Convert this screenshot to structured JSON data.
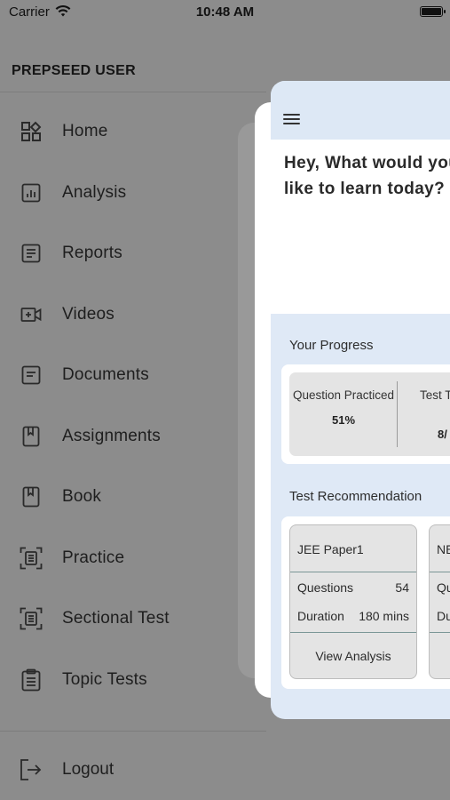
{
  "status_bar": {
    "carrier": "Carrier",
    "time": "10:48 AM"
  },
  "drawer": {
    "title": "PREPSEED USER",
    "items": [
      {
        "label": "Home",
        "icon": "home-grid-icon"
      },
      {
        "label": "Analysis",
        "icon": "analysis-chart-icon"
      },
      {
        "label": "Reports",
        "icon": "reports-document-icon"
      },
      {
        "label": "Videos",
        "icon": "video-icon"
      },
      {
        "label": "Documents",
        "icon": "documents-icon"
      },
      {
        "label": "Assignments",
        "icon": "assignments-book-icon"
      },
      {
        "label": "Book",
        "icon": "book-icon"
      },
      {
        "label": "Practice",
        "icon": "practice-scan-icon"
      },
      {
        "label": "Sectional Test",
        "icon": "sectional-test-scan-icon"
      },
      {
        "label": "Topic Tests",
        "icon": "clipboard-icon"
      }
    ],
    "logout_label": "Logout"
  },
  "main": {
    "greeting": "Hey, What would you like to learn today?",
    "progress": {
      "label": "Your Progress",
      "col1_title": "Question Practiced",
      "col1_value": "51%",
      "col2_title": "Test T",
      "col2_value": "8/"
    },
    "recommendation": {
      "label": "Test Recommendation",
      "card1": {
        "name": "JEE Paper1",
        "questions_label": "Questions",
        "questions_value": "54",
        "duration_label": "Duration",
        "duration_value": "180 mins",
        "button": "View Analysis"
      },
      "card2": {
        "name": "NE",
        "questions_label": "Qu",
        "duration_label": "Du"
      }
    }
  }
}
